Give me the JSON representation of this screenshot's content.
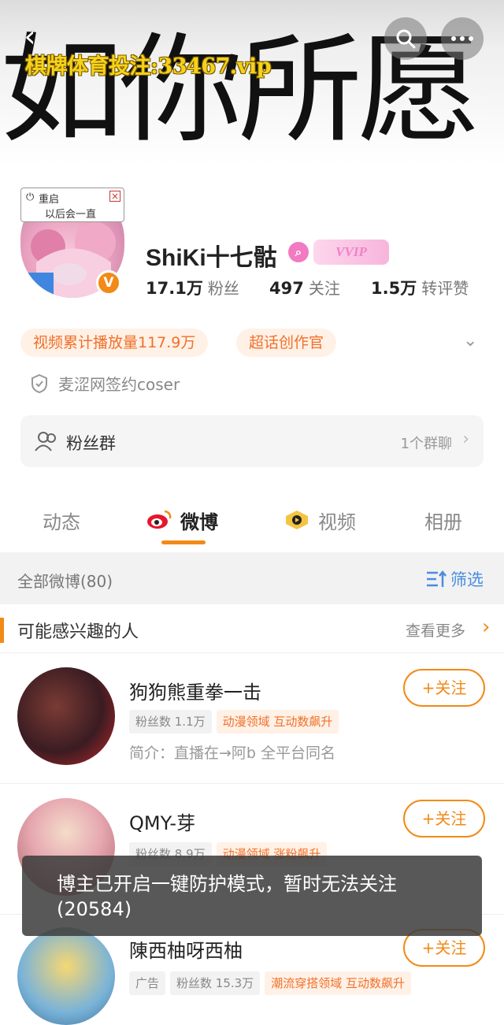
{
  "banner": {
    "art_text": "如你所愿",
    "watermark": "棋牌体育投注:33467.vip"
  },
  "nav": {
    "back_icon": "back-arrow-icon",
    "search_icon": "search-icon",
    "more_icon": "more-icon"
  },
  "avatar_popup": {
    "restart": "重启",
    "later": "以后会一直"
  },
  "profile": {
    "name": "ShiKi十七骷",
    "vip_label": "VVIP",
    "stats": [
      {
        "num": "17.1万",
        "label": "粉丝"
      },
      {
        "num": "497",
        "label": "关注"
      },
      {
        "num": "1.5万",
        "label": "转评赞"
      }
    ],
    "tags": [
      "视频累计播放量117.9万",
      "超话创作官"
    ],
    "signed": "麦涩网签约coser"
  },
  "fans_group": {
    "label": "粉丝群",
    "right": "1个群聊"
  },
  "tabs": [
    "动态",
    "微博",
    "视频",
    "相册"
  ],
  "filter": {
    "all_posts": "全部微博(80)",
    "filter_label": "筛选"
  },
  "suggest": {
    "title": "可能感兴趣的人",
    "more": "查看更多"
  },
  "people": [
    {
      "name": "狗狗熊重拳一击",
      "chips": [
        {
          "text": "粉丝数 1.1万",
          "style": "gray"
        },
        {
          "text": "动漫领域 互动数飙升",
          "style": "orange"
        }
      ],
      "intro": "简介：直播在→阿b 全平台同名",
      "follow": "关注"
    },
    {
      "name": "QMY-芽",
      "chips": [
        {
          "text": "粉丝数 8.9万",
          "style": "gray"
        },
        {
          "text": "动漫领域 涨粉飙升",
          "style": "orange"
        }
      ],
      "intro": "",
      "follow": "关注"
    },
    {
      "name": "陳西柚呀西柚",
      "chips": [
        {
          "text": "广告",
          "style": "gray"
        },
        {
          "text": "粉丝数 15.3万",
          "style": "gray"
        },
        {
          "text": "潮流穿搭领域 互动数飙升",
          "style": "orange"
        }
      ],
      "intro": "",
      "follow": "关注"
    }
  ],
  "toast": "博主已开启一键防护模式，暂时无法关注(20584)",
  "colors": {
    "accent": "#f28a17",
    "tag_text": "#f0702b",
    "tag_bg": "#fff1e6"
  }
}
